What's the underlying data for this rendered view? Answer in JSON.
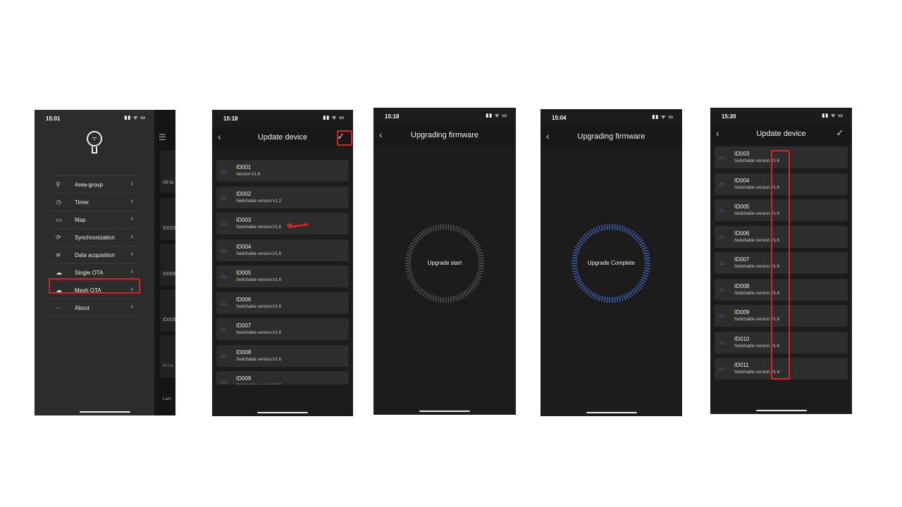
{
  "colors": {
    "accent_blue": "#3f6bc8",
    "highlight_red": "#e02020"
  },
  "phone1": {
    "time": "15:01",
    "status_icons": "signal wifi battery",
    "logo": "bulb-wifi-logo",
    "menu": [
      {
        "label": "Area-group",
        "icon": "location-person-icon"
      },
      {
        "label": "Timer",
        "icon": "timer-icon"
      },
      {
        "label": "Map",
        "icon": "map-icon"
      },
      {
        "label": "Synchronization",
        "icon": "sync-cloud-icon"
      },
      {
        "label": "Data acquisition",
        "icon": "rss-icon"
      },
      {
        "label": "Single OTA",
        "icon": "cloud-upload-icon"
      },
      {
        "label": "Mesh OTA",
        "icon": "cloud-upload-icon",
        "highlighted": true
      },
      {
        "label": "About",
        "icon": "ellipsis-circle-icon"
      }
    ],
    "background_peek": {
      "labels": [
        "All la",
        "ID003",
        "ID006",
        "ID009",
        "A-La",
        "Lam"
      ]
    }
  },
  "phone2": {
    "time": "15:18",
    "title": "Update device",
    "devices": [
      {
        "id": "ID001",
        "version": "Version:V1.6"
      },
      {
        "id": "ID002",
        "version": "Switchable version:V1.2"
      },
      {
        "id": "ID003",
        "version": "Switchable version:V1.6"
      },
      {
        "id": "ID004",
        "version": "Switchable version:V1.6"
      },
      {
        "id": "ID005",
        "version": "Switchable version:V1.6"
      },
      {
        "id": "ID006",
        "version": "Switchable version:V1.6"
      },
      {
        "id": "ID007",
        "version": "Switchable version:V1.6"
      },
      {
        "id": "ID008",
        "version": "Switchable version:V1.6"
      },
      {
        "id": "ID009",
        "version": "Switchable version:V1.6"
      }
    ]
  },
  "phone3": {
    "time": "15:18",
    "title": "Upgrading firmware",
    "status": "Upgrade start",
    "progress": 0
  },
  "phone4": {
    "time": "15:04",
    "title": "Upgrading firmware",
    "status": "Upgrade Complete",
    "progress": 100
  },
  "phone5": {
    "time": "15:20",
    "title": "Update device",
    "devices": [
      {
        "id": "ID003",
        "version": "Switchable version:V1.6"
      },
      {
        "id": "ID004",
        "version": "Switchable version:V1.6"
      },
      {
        "id": "ID005",
        "version": "Switchable version:V1.6"
      },
      {
        "id": "ID006",
        "version": "Switchable version:V1.6"
      },
      {
        "id": "ID007",
        "version": "Switchable version:V1.6"
      },
      {
        "id": "ID008",
        "version": "Switchable version:V1.6"
      },
      {
        "id": "ID009",
        "version": "Switchable version:V1.6"
      },
      {
        "id": "ID010",
        "version": "Switchable version:V1.6"
      },
      {
        "id": "ID011",
        "version": "Switchable version:V1.6"
      }
    ]
  }
}
